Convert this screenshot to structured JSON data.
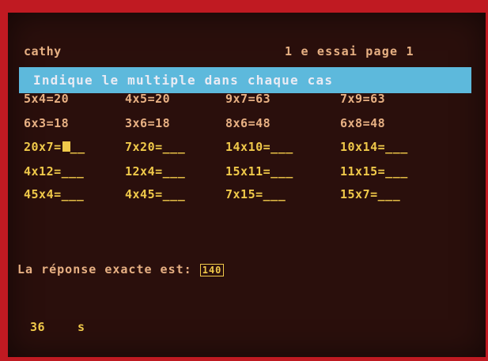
{
  "header": {
    "user": "cathy",
    "page_info": "1 e essai page 1"
  },
  "banner": {
    "instruction": "Indique le multiple dans chaque cas"
  },
  "grid": {
    "row1": [
      "5x4=20",
      "4x5=20",
      "9x7=63",
      "7x9=63"
    ],
    "row2": [
      "6x3=18",
      "3x6=18",
      "8x6=48",
      "6x8=48"
    ],
    "row3": [
      "20x7=",
      "7x20=___",
      "14x10=___",
      "10x14=___"
    ],
    "row3_blank": "__",
    "row4": [
      "4x12=___",
      "12x4=___",
      "15x11=___",
      "11x15=___"
    ],
    "row5": [
      "45x4=___",
      "4x45=___",
      "7x15=___",
      "15x7=___"
    ]
  },
  "answer": {
    "label": "La réponse exacte est:",
    "value": "140"
  },
  "footer": {
    "timer": "36",
    "unit": "s"
  }
}
